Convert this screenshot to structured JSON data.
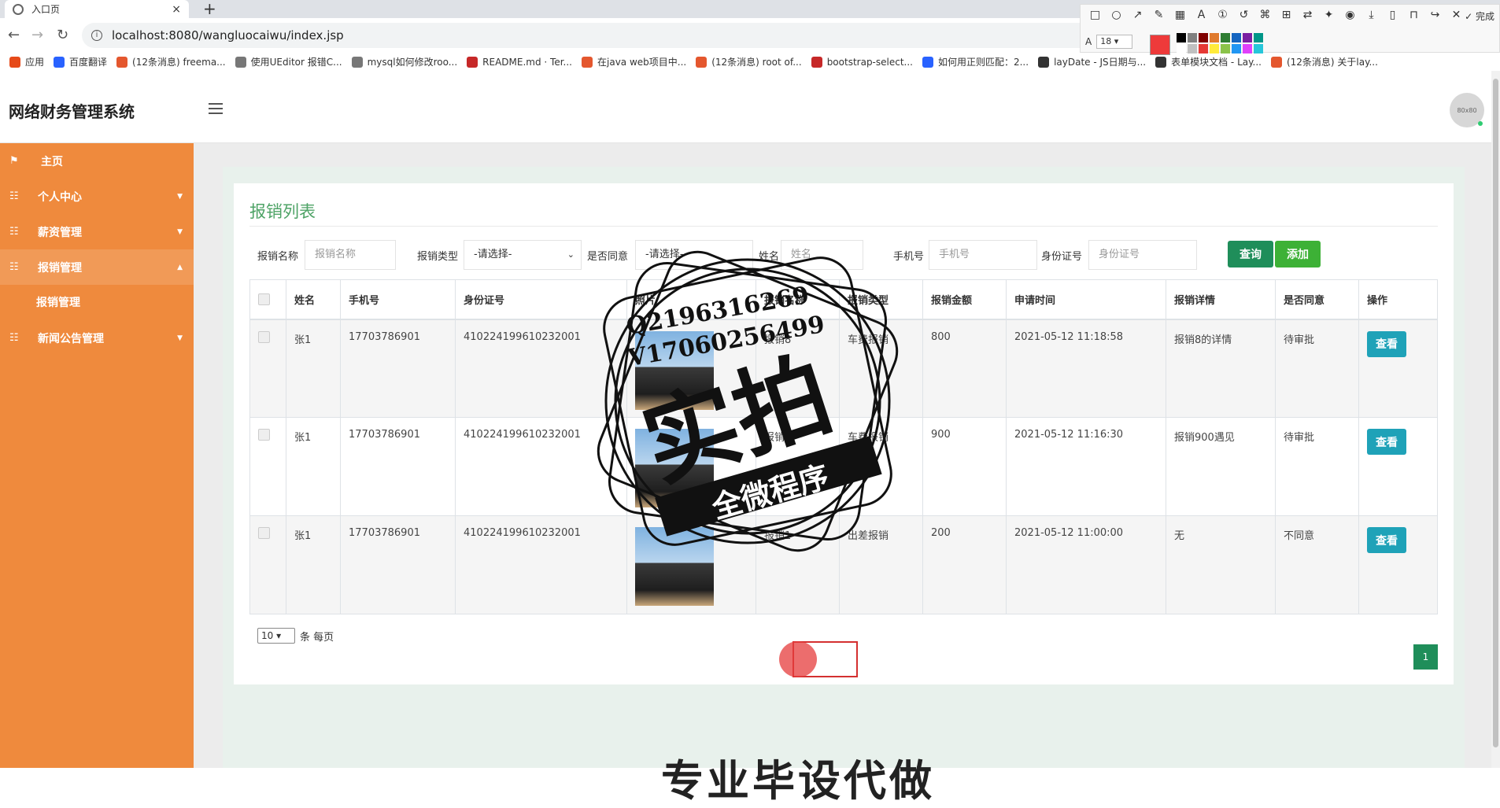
{
  "browser": {
    "tab_title": "入口页",
    "tab_close": "×",
    "new_tab": "+",
    "url": "localhost:8080/wangluocaiwu/index.jsp",
    "bookmarks": [
      {
        "label": "应用",
        "color": "#e64a19"
      },
      {
        "label": "百度翻译",
        "color": "#2962ff"
      },
      {
        "label": "(12条消息) freema...",
        "color": "#e4572e"
      },
      {
        "label": "使用UEditor 报错C...",
        "color": "#777777"
      },
      {
        "label": "mysql如何修改roo...",
        "color": "#777777"
      },
      {
        "label": "README.md · Ter...",
        "color": "#c62828"
      },
      {
        "label": "在java web项目中...",
        "color": "#e4572e"
      },
      {
        "label": "(12条消息) root of...",
        "color": "#e4572e"
      },
      {
        "label": "bootstrap-select...",
        "color": "#c62828"
      },
      {
        "label": "如何用正则匹配：2...",
        "color": "#2962ff"
      },
      {
        "label": "layDate - JS日期与...",
        "color": "#333333"
      },
      {
        "label": "表单模块文档 - Lay...",
        "color": "#333333"
      },
      {
        "label": "(12条消息) 关于lay...",
        "color": "#e4572e"
      }
    ]
  },
  "annotation_toolbar": {
    "done_label": "✓ 完成",
    "font_size": "18",
    "main_color": "#ee3a3a",
    "swatches": [
      "#000000",
      "#808080",
      "#800000",
      "#e07a2e",
      "#2e7d32",
      "#1565c0",
      "#7b1fa2",
      "#009688",
      "#ffffff",
      "#c0c0c0",
      "#e53935",
      "#ffeb3b",
      "#8bc34a",
      "#2196f3",
      "#e040fb",
      "#26c6da"
    ]
  },
  "app": {
    "title": "网络财务管理系统",
    "avatar_text": "80x80"
  },
  "sidebar": {
    "items": [
      {
        "label": "主页",
        "icon": "flag-icon",
        "arrow": ""
      },
      {
        "label": "个人中心",
        "icon": "grid-icon",
        "arrow": "▼"
      },
      {
        "label": "薪资管理",
        "icon": "grid-icon",
        "arrow": "▼"
      },
      {
        "label": "报销管理",
        "icon": "grid-icon",
        "arrow": "▲"
      },
      {
        "label": "新闻公告管理",
        "icon": "grid-icon",
        "arrow": "▼"
      }
    ],
    "sub_item": "报销管理"
  },
  "main": {
    "title": "报销列表",
    "filters": {
      "name_label": "报销名称",
      "name_placeholder": "报销名称",
      "type_label": "报销类型",
      "type_value": "-请选择-",
      "agree_label": "是否同意",
      "agree_value": "-请选择-",
      "person_label": "姓名",
      "person_placeholder": "姓名",
      "phone_label": "手机号",
      "phone_placeholder": "手机号",
      "id_label": "身份证号",
      "id_placeholder": "身份证号",
      "search_button": "查询",
      "add_button": "添加"
    },
    "table": {
      "headers": [
        "姓名",
        "手机号",
        "身份证号",
        "照片",
        "报销名称",
        "报销类型",
        "报销金额",
        "申请时间",
        "报销详情",
        "是否同意",
        "操作"
      ],
      "rows": [
        {
          "name": "张1",
          "phone": "17703786901",
          "id": "410224199610232001",
          "title": "报销8",
          "type": "车费报销",
          "amount": "800",
          "time": "2021-05-12 11:18:58",
          "detail": "报销8的详情",
          "status": "待审批",
          "action": "查看"
        },
        {
          "name": "张1",
          "phone": "17703786901",
          "id": "410224199610232001",
          "title": "报销",
          "type": "车费报销",
          "amount": "900",
          "time": "2021-05-12 11:16:30",
          "detail": "报销900遇见",
          "status": "待审批",
          "action": "查看"
        },
        {
          "name": "张1",
          "phone": "17703786901",
          "id": "410224199610232001",
          "title": "报销1",
          "type": "出差报销",
          "amount": "200",
          "time": "2021-05-12 11:00:00",
          "detail": "无",
          "status": "不同意",
          "action": "查看"
        }
      ]
    },
    "per_page_value": "10",
    "per_page_suffix": "条 每页",
    "current_page": "1"
  },
  "watermark": {
    "line1": "Q2196316269",
    "line2": "V17060256499",
    "big": "实拍",
    "ribbon": "全微程序",
    "bottom_text": "专业毕设代做"
  }
}
